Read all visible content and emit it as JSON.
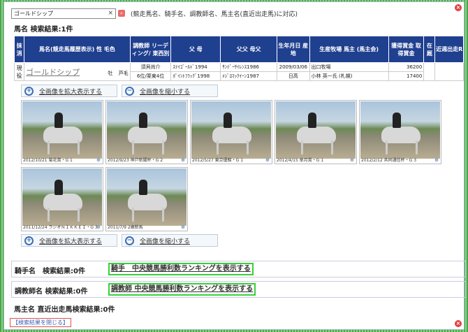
{
  "search": {
    "value": "ゴールドシップ",
    "clear_glyph": "×",
    "hint": "(競走馬名、騎手名、調教師名、馬主名(直近出走馬)に対応)"
  },
  "horse_section": {
    "title": "馬名 検索結果:1件",
    "headers": {
      "c1": "抹消",
      "c2": "馬名(競走馬履歴表示) 性 毛色",
      "c3": "調教師 リーディング/ 東西別",
      "c4": "父 母",
      "c5": "父父 母父",
      "c6": "生年月日 産地",
      "c7": "生産牧場 馬主 (馬主会)",
      "c8": "獲得賞金 取得賞金",
      "c9": "在厩",
      "c10": "近週出走R"
    },
    "row": {
      "status": "現役",
      "name": "ゴールドシップ",
      "sex": "牡",
      "color": "芦毛",
      "trainer": "須貝尚介",
      "trainer_rank": "6位/栗東4位",
      "sire": "ｽﾃｲｺﾞｰﾙﾄﾞ1994",
      "dam": "ﾎﾟｲﾝﾄﾌﾗｯｸﾞ1998",
      "sire_sire": "ｻﾝﾃﾞｰｻｲﾚﾝｽ1986",
      "dam_sire": "ﾒｼﾞﾛﾏｯｸｲｰﾝ1987",
      "birth": "2009/03/06",
      "region": "日高",
      "breeder": "出口牧場",
      "owner": "小林 英一氏 (札幌)",
      "earned": "36200",
      "acquired": "17400"
    }
  },
  "zoom": {
    "expand": "全画像を拡大表示する",
    "shrink": "全画像を縮小する"
  },
  "photos": [
    {
      "caption": "2012/10/21 菊花賞・G 1"
    },
    {
      "caption": "2012/9/23 神戸新聞杯・G 2"
    },
    {
      "caption": "2012/5/27 東京優駿・G 1"
    },
    {
      "caption": "2012/4/15 皐月賞・G 1"
    },
    {
      "caption": "2012/2/12 共同通信杯・G 3"
    },
    {
      "caption": "2011/12/24 ラジオＮＩＫＫＥＩ・G 3"
    },
    {
      "caption": "2011/7/9 2歳新馬"
    }
  ],
  "jockey": {
    "title": "騎手名　検索結果:0件",
    "button": "騎手　中央競馬勝利数ランキングを表示する"
  },
  "trainer": {
    "title": "調教師名 検索結果:0件",
    "button": "調教師 中央競馬勝利数ランキングを表示する"
  },
  "owner_section": {
    "title": "馬主名 直近出走馬検索結果:0件"
  },
  "close_link": "【検索結果を閉じる】",
  "icons": {
    "close": "close-icon",
    "zoom_in": "zoom-in-icon",
    "zoom_out": "zoom-out-icon",
    "magnify": "magnify-icon"
  },
  "colors": {
    "header_bg": "#1f3f8f",
    "rank_border": "#39d03a",
    "close_red": "#e04040"
  }
}
